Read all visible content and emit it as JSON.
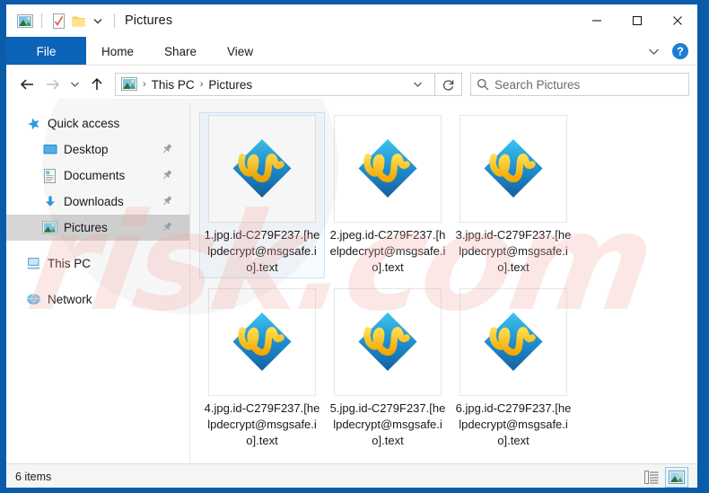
{
  "window": {
    "title": "Pictures",
    "quick_access_icons": [
      "pictures-folder-icon",
      "properties-icon",
      "new-folder-icon",
      "customize-qat-chevron-icon"
    ],
    "controls": {
      "minimize": "–",
      "maximize": "☐",
      "close": "✕"
    }
  },
  "ribbon": {
    "tabs": [
      {
        "label": "File",
        "active": true
      },
      {
        "label": "Home",
        "active": false
      },
      {
        "label": "Share",
        "active": false
      },
      {
        "label": "View",
        "active": false
      }
    ],
    "expand_label": "expand-ribbon-chevron-icon",
    "help_label": "?"
  },
  "address_bar": {
    "back": "←",
    "forward": "→",
    "recent": "recent-locations-chevron-icon",
    "up": "↑",
    "crumbs": [
      "This PC",
      "Pictures"
    ],
    "separator": "›",
    "refresh": "↻"
  },
  "search": {
    "placeholder": "Search Pictures",
    "value": "",
    "icon": "search-icon"
  },
  "sidebar": {
    "groups": [
      {
        "header": {
          "label": "Quick access",
          "icon": "star-pin-icon"
        },
        "items": [
          {
            "label": "Desktop",
            "icon": "desktop-icon",
            "pinned": true,
            "selected": false
          },
          {
            "label": "Documents",
            "icon": "documents-icon",
            "pinned": true,
            "selected": false
          },
          {
            "label": "Downloads",
            "icon": "downloads-icon",
            "pinned": true,
            "selected": false
          },
          {
            "label": "Pictures",
            "icon": "pictures-icon",
            "pinned": true,
            "selected": true
          }
        ]
      },
      {
        "header": {
          "label": "This PC",
          "icon": "this-pc-icon"
        },
        "items": []
      },
      {
        "header": {
          "label": "Network",
          "icon": "network-icon"
        },
        "items": []
      }
    ]
  },
  "files": [
    {
      "name": "1.jpg.id-C279F237.[helpdecrypt@msgsafe.io].text",
      "selected": true
    },
    {
      "name": "2.jpeg.id-C279F237.[helpdecrypt@msgsafe.io].text",
      "selected": false
    },
    {
      "name": "3.jpg.id-C279F237.[helpdecrypt@msgsafe.io].text",
      "selected": false
    },
    {
      "name": "4.jpg.id-C279F237.[helpdecrypt@msgsafe.io].text",
      "selected": false
    },
    {
      "name": "5.jpg.id-C279F237.[helpdecrypt@msgsafe.io].text",
      "selected": false
    },
    {
      "name": "6.jpg.id-C279F237.[helpdecrypt@msgsafe.io].text",
      "selected": false
    }
  ],
  "status": {
    "items_text": "6 items",
    "views": [
      {
        "name": "details-view",
        "active": false
      },
      {
        "name": "large-icons-view",
        "active": true
      }
    ]
  },
  "watermark": {
    "text": "risk.com"
  },
  "colors": {
    "window_border": "#0b5ca8",
    "file_tab": "#0c64b8",
    "selection": "#cce8ff",
    "nav_selected": "#d6d6d6",
    "icon_blue": "#29a9e0",
    "icon_yellow": "#ffc400"
  }
}
